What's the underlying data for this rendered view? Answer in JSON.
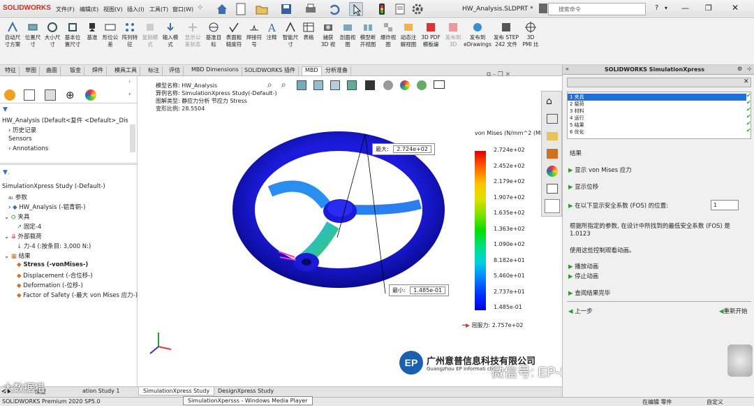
{
  "app": {
    "logo": "SOLIDWORKS",
    "menus": [
      "文件(F)",
      "编辑(E)",
      "视图(V)",
      "插入(I)",
      "工具(T)",
      "窗口(W)"
    ],
    "doc_title": "HW_Analysis.SLDPRT *",
    "search_placeholder": "搜索命令"
  },
  "commands": [
    {
      "l1": "自动尺",
      "l2": "寸方案"
    },
    {
      "l1": "位置尺",
      "l2": "寸"
    },
    {
      "l1": "大小尺",
      "l2": "寸"
    },
    {
      "l1": "基本位",
      "l2": "置尺寸"
    },
    {
      "l1": "基准",
      "l2": ""
    },
    {
      "l1": "形位公",
      "l2": "差"
    },
    {
      "l1": "阵列特",
      "l2": "征"
    },
    {
      "l1": "复制模",
      "l2": "式"
    },
    {
      "l1": "输入模",
      "l2": "式"
    },
    {
      "l1": "显示公",
      "l2": "差状态"
    },
    {
      "l1": "基准目",
      "l2": "标"
    },
    {
      "l1": "表面粗",
      "l2": "糙度符"
    },
    {
      "l1": "焊接符",
      "l2": "号"
    },
    {
      "l1": "注释",
      "l2": ""
    },
    {
      "l1": "智能尺",
      "l2": "寸"
    },
    {
      "l1": "表格",
      "l2": ""
    },
    {
      "l1": "捕获",
      "l2": "3D 视"
    },
    {
      "l1": "剖面视",
      "l2": "图"
    },
    {
      "l1": "模型断",
      "l2": "开视图"
    },
    {
      "l1": "爆炸视",
      "l2": "图"
    },
    {
      "l1": "动态注",
      "l2": "解视图"
    },
    {
      "l1": "3D PDF",
      "l2": "模板编"
    },
    {
      "l1": "发布到",
      "l2": "3D"
    },
    {
      "l1": "发布到",
      "l2": "eDrawings"
    },
    {
      "l1": "发布 STEP",
      "l2": "242 文件"
    },
    {
      "l1": "3D",
      "l2": "PMI 比"
    }
  ],
  "tabs": [
    "特征",
    "草图",
    "曲面",
    "钣金",
    "焊件",
    "模具工具",
    "标注",
    "评估",
    "MBD Dimensions",
    "SOLIDWORKS 插件",
    "MBD",
    "分析准备"
  ],
  "tree": {
    "part": "HW_Analysis (Default<复件 <Default>_Dis",
    "items": [
      "历史记录",
      "Sensors",
      "Annotations"
    ],
    "study": "SimulationXpress Study (-Default-)",
    "params": "参数",
    "solid": "HW_Analysis (-铝青铜-)",
    "fixtures": "夹具",
    "fixed": "固定-4",
    "loads": "外部载荷",
    "force": "力-4 (:按条目: 3,000 N:)",
    "results": "结果",
    "stress": "Stress (-vonMises-)",
    "disp": "Displacement (-合位移-)",
    "deform": "Deformation (-位移-)",
    "fos": "Factor of Safety (-最大 von Mises 应力-)"
  },
  "viewport": {
    "model": "模型名称: HW_Analysis",
    "study": "算例名称: SimulationXpress Study(-Default-)",
    "type": "图解类型: 静应力分析 节应力 Stress",
    "scale": "变形比例: 28.5504",
    "max_label": "最大:",
    "max_val": "2.724e+02",
    "min_label": "最小:",
    "min_val": "1.485e-01",
    "legend_title": "von Mises (N/mm^2 (MP",
    "legend_vals": [
      "2.724e+02",
      "2.452e+02",
      "2.179e+02",
      "1.907e+02",
      "1.635e+02",
      "1.363e+02",
      "1.090e+02",
      "8.182e+01",
      "5.460e+01",
      "2.737e+01",
      "1.485e-01"
    ],
    "yield": "屈服力: 2.757e+02",
    "company": "广州意普信息科技有限公司",
    "company_en": "Guangzhou EP Informati",
    "company_en2": "chn",
    "watermark": "微信号: EP-SOLIDWORKS"
  },
  "sx": {
    "title": "SOLIDWORKS SimulationXpress",
    "steps": [
      "1 夹具",
      "2 载荷",
      "3 材料",
      "4 运行",
      "5 结果",
      "6 优化"
    ],
    "results_heading": "结果",
    "show_vm": "显示  von Mises 应力",
    "show_disp": "显示位移",
    "show_fos": "在以下显示安全系数 (FOS) 的位置:",
    "fos_input": "1",
    "desc": "根据所指定的参数, 在设计中所找到的最低安全系数 (FOS) 是 1.0123",
    "anim_hint": "使用这些控制观看动画。",
    "play": "播放动画",
    "stop": "停止动画",
    "done": "查阅结果完毕",
    "prev": "上一步",
    "restart": "重新开始"
  },
  "bottom_tabs": [
    "模型",
    "ation Study 1",
    "SimulationXpress Study",
    "DesignXpress Study"
  ],
  "bottom_overlay": "大数据猎",
  "status": {
    "left": "SOLIDWORKS Premium 2020 SP5.0",
    "center": "SimulationXpersss - Windows Media Player",
    "editing": "在编辑 零件",
    "custom": "自定义"
  }
}
